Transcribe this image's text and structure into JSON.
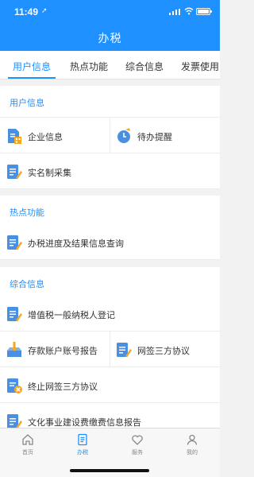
{
  "status": {
    "time": "11:49",
    "location_arrow": "➚"
  },
  "header": {
    "title": "办税"
  },
  "tabs": [
    {
      "label": "用户信息"
    },
    {
      "label": "热点功能"
    },
    {
      "label": "综合信息"
    },
    {
      "label": "发票使用"
    }
  ],
  "sections": {
    "user_info": {
      "title": "用户信息",
      "items": [
        {
          "label": "企业信息",
          "icon": "building-doc-icon"
        },
        {
          "label": "待办提醒",
          "icon": "reminder-clock-icon"
        },
        {
          "label": "实名制采集",
          "icon": "edit-doc-icon"
        }
      ]
    },
    "hot": {
      "title": "热点功能",
      "items": [
        {
          "label": "办税进度及结果信息查询",
          "icon": "edit-doc-icon"
        }
      ]
    },
    "general": {
      "title": "综合信息",
      "items": [
        {
          "label": "增值税一般纳税人登记",
          "icon": "edit-doc-icon"
        },
        {
          "label": "存款账户账号报告",
          "icon": "download-tray-icon"
        },
        {
          "label": "网签三方协议",
          "icon": "edit-doc-icon"
        },
        {
          "label": "终止网签三方协议",
          "icon": "cancel-doc-icon"
        },
        {
          "label": "文化事业建设费缴费信息报告",
          "icon": "edit-doc-icon"
        }
      ]
    }
  },
  "tabbar": [
    {
      "label": "首页",
      "icon": "home-icon"
    },
    {
      "label": "办税",
      "icon": "tax-doc-icon"
    },
    {
      "label": "服务",
      "icon": "heart-icon"
    },
    {
      "label": "我的",
      "icon": "user-icon"
    }
  ],
  "colors": {
    "primary": "#1e90ff",
    "icon_blue": "#4a90e2",
    "icon_orange": "#f5a623",
    "background": "#f2f2f2"
  }
}
